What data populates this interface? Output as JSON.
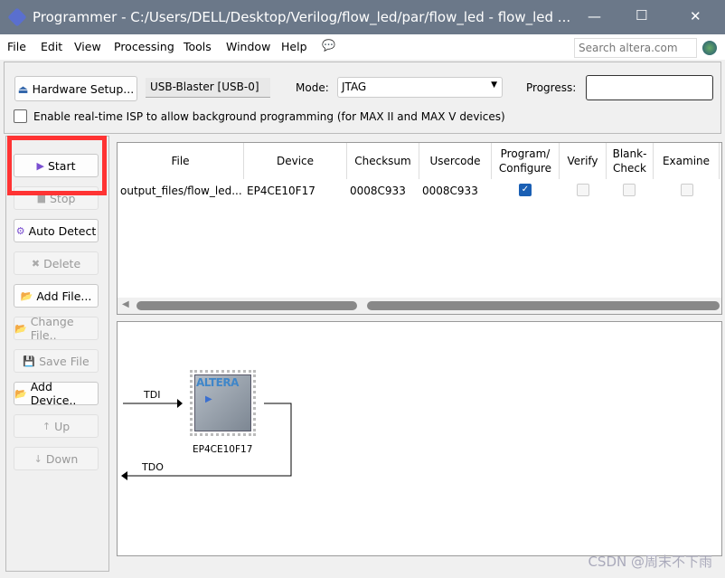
{
  "window": {
    "title": "Programmer - C:/Users/DELL/Desktop/Verilog/flow_led/par/flow_led - flow_led ...",
    "minimize": "—",
    "maximize": "☐",
    "close": "✕"
  },
  "menu": [
    "File",
    "Edit",
    "View",
    "Processing",
    "Tools",
    "Window",
    "Help"
  ],
  "search": {
    "placeholder": "Search altera.com"
  },
  "toolbar": {
    "hardware_setup": "Hardware Setup...",
    "hardware": "USB-Blaster [USB-0]",
    "mode_label": "Mode:",
    "mode": "JTAG",
    "progress_label": "Progress:",
    "isp_label": "Enable real-time ISP to allow background programming (for MAX II and MAX V devices)"
  },
  "buttons": [
    {
      "label": "Start",
      "icon": "start-icon",
      "enabled": true
    },
    {
      "label": "Stop",
      "icon": "stop-icon",
      "enabled": false
    },
    {
      "label": "Auto Detect",
      "icon": "auto-detect-icon",
      "enabled": true
    },
    {
      "label": "Delete",
      "icon": "delete-icon",
      "enabled": false
    },
    {
      "label": "Add File...",
      "icon": "add-file-icon",
      "enabled": true
    },
    {
      "label": "Change File..",
      "icon": "change-file-icon",
      "enabled": false
    },
    {
      "label": "Save File",
      "icon": "save-file-icon",
      "enabled": false
    },
    {
      "label": "Add Device..",
      "icon": "add-device-icon",
      "enabled": true
    },
    {
      "label": "Up",
      "icon": "up-icon",
      "enabled": false
    },
    {
      "label": "Down",
      "icon": "down-icon",
      "enabled": false
    }
  ],
  "table": {
    "headers": [
      "File",
      "Device",
      "Checksum",
      "Usercode",
      "Program/ Configure",
      "Verify",
      "Blank- Check",
      "Examine"
    ],
    "rows": [
      {
        "file": "output_files/flow_led...",
        "device": "EP4CE10F17",
        "checksum": "0008C933",
        "usercode": "0008C933",
        "program": true,
        "verify": false,
        "blank_check": false,
        "examine": false
      }
    ]
  },
  "diagram": {
    "tdi": "TDI",
    "tdo": "TDO",
    "chip_label": "EP4CE10F17",
    "logo": "ALTERA"
  },
  "watermark": "CSDN @周末不下雨",
  "colors": {
    "highlight": "#ff3333",
    "checkbox": "#1a5fb4",
    "titlebar": "#6b7889"
  }
}
